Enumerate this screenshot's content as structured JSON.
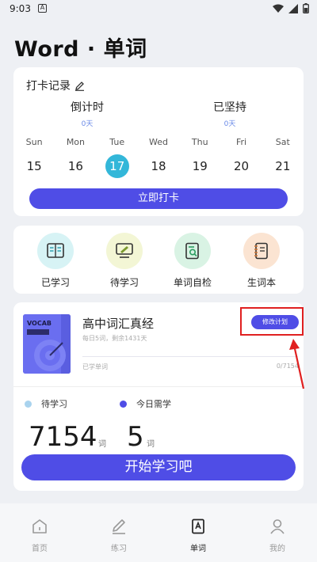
{
  "status_bar": {
    "time": "9:03",
    "badge": "A"
  },
  "page": {
    "title": "Word · 单词"
  },
  "checkin": {
    "title": "打卡记录",
    "countdown": {
      "label": "倒计时",
      "value": "0天"
    },
    "streak": {
      "label": "已坚持",
      "value": "0天"
    },
    "week": [
      {
        "name": "Sun",
        "num": "15"
      },
      {
        "name": "Mon",
        "num": "16"
      },
      {
        "name": "Tue",
        "num": "17",
        "today": true
      },
      {
        "name": "Wed",
        "num": "18"
      },
      {
        "name": "Thu",
        "num": "19"
      },
      {
        "name": "Fri",
        "num": "20"
      },
      {
        "name": "Sat",
        "num": "21"
      }
    ],
    "button": "立即打卡"
  },
  "tools": [
    {
      "label": "已学习",
      "icon": "book-icon",
      "bg": "#d7f3f5",
      "fg": "#3aa7b5"
    },
    {
      "label": "待学习",
      "icon": "monitor-icon",
      "bg": "#f3f6d5",
      "fg": "#7b9a2e"
    },
    {
      "label": "单词自检",
      "icon": "search-doc-icon",
      "bg": "#d9f3e4",
      "fg": "#2d9d62"
    },
    {
      "label": "生词本",
      "icon": "notebook-icon",
      "bg": "#fbe4d2",
      "fg": "#d07a3c"
    }
  ],
  "plan": {
    "cover_text": "VOCAB",
    "book_title": "高中词汇真经",
    "book_sub": "每日5词，剩余1431天",
    "plan_button": "修改计划",
    "progress_label": "已学单词",
    "progress_count": "0/7154",
    "progress_fraction": 0,
    "legend_pending": "待学习",
    "legend_today": "今日需学",
    "pending_count": "7154",
    "pending_unit": "词",
    "today_count": "5",
    "today_unit": "词",
    "start_button": "开始学习吧"
  },
  "tabs": [
    {
      "label": "首页",
      "icon": "home-icon"
    },
    {
      "label": "练习",
      "icon": "pencil-icon"
    },
    {
      "label": "单词",
      "icon": "word-icon",
      "active": true
    },
    {
      "label": "我的",
      "icon": "user-icon"
    }
  ],
  "colors": {
    "accent": "#4f4de6",
    "today": "#33b7d9",
    "highlight": "#e02020",
    "legend_pending": "#a9d3ee",
    "legend_today": "#4f4de6"
  }
}
